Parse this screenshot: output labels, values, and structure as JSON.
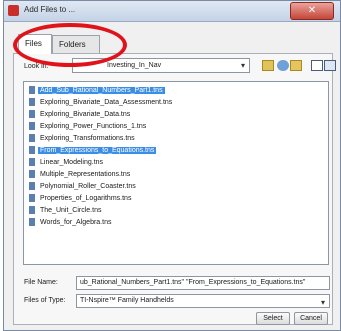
{
  "window": {
    "title": "Add Files to ...",
    "close_glyph": "✕"
  },
  "tabs": [
    {
      "label": "Files"
    },
    {
      "label": "Folders"
    }
  ],
  "look_in": {
    "label": "Look in:",
    "value": "Investing_In_Nav"
  },
  "files": [
    "Add_Sub_Rational_Numbers_Part1.tns",
    "Exploring_Bivariate_Data_Assessment.tns",
    "Exploring_Bivariate_Data.tns",
    "Exploring_Power_Functions_1.tns",
    "Exploring_Transformations.tns",
    "From_Expressions_to_Equations.tns",
    "Linear_Modeling.tns",
    "Multiple_Representations.tns",
    "Polynomial_Roller_Coaster.tns",
    "Properties_of_Logarithms.tns",
    "The_Unit_Circle.tns",
    "Words_for_Algebra.tns"
  ],
  "file_name": {
    "label": "File Name:",
    "value": "ub_Rational_Numbers_Part1.tns\" \"From_Expressions_to_Equations.tns\""
  },
  "files_of_type": {
    "label": "Files of Type:",
    "value": "TI-Nspire™ Family Handhelds"
  },
  "buttons": {
    "select": "Select",
    "cancel": "Cancel"
  },
  "icons": {
    "app": "app-icon",
    "up_folder": "up-folder-icon",
    "web": "web-icon",
    "new_folder": "new-folder-icon",
    "list_view": "list-view-icon",
    "details_view": "details-view-icon",
    "dropdown": "chevron-down-icon",
    "file": "tns-file-icon"
  },
  "colors": {
    "selection": "#3b8ee6",
    "annotation_ellipse": "#e0131b",
    "close_button": "#c4463a"
  }
}
